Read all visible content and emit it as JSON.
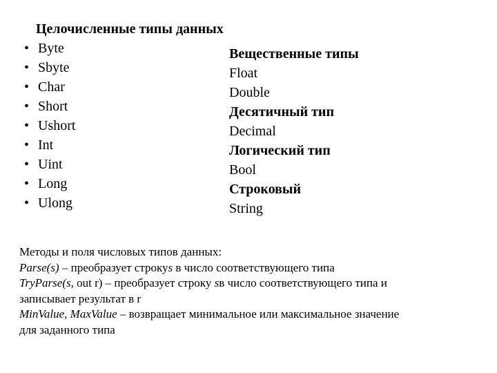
{
  "slide": {
    "integer_section": {
      "title": "Целочисленные типы данных",
      "bullet_glyph": "•",
      "items": [
        "Byte",
        "Sbyte",
        "Char",
        "Short",
        "Ushort",
        "Int",
        "Uint",
        "Long",
        "Ulong"
      ]
    },
    "other_types": {
      "lines": [
        {
          "text": "Вещественные типы",
          "bold": true
        },
        {
          "text": "Float",
          "bold": false
        },
        {
          "text": "Double",
          "bold": false
        },
        {
          "text": "Десятичный тип",
          "bold": true
        },
        {
          "text": "Decimal",
          "bold": false
        },
        {
          "text": "Логический тип",
          "bold": true
        },
        {
          "text": "Bool",
          "bold": false
        },
        {
          "text": "Строковый",
          "bold": true
        },
        {
          "text": "String",
          "bold": false
        }
      ]
    },
    "notes": {
      "heading": "Методы и поля числовых типов данных:",
      "parse_name": "Parse(s)",
      "parse_desc": " – преобразует строку",
      "parse_arg": "s",
      "parse_tail": " в число соответствующего типа",
      "tryparse_name": "TryParse(s,",
      "tryparse_rest": " out r) – преобразует строку ",
      "tryparse_arg": "s",
      "tryparse_tail": "в число соответствующего типа и",
      "tryparse_line2": "записывает результат в r",
      "minmax_name": "MinValue, MaxValue",
      "minmax_desc": " – возвращает минимальное или максимальное значение",
      "minmax_line2": "для заданного типа"
    }
  }
}
